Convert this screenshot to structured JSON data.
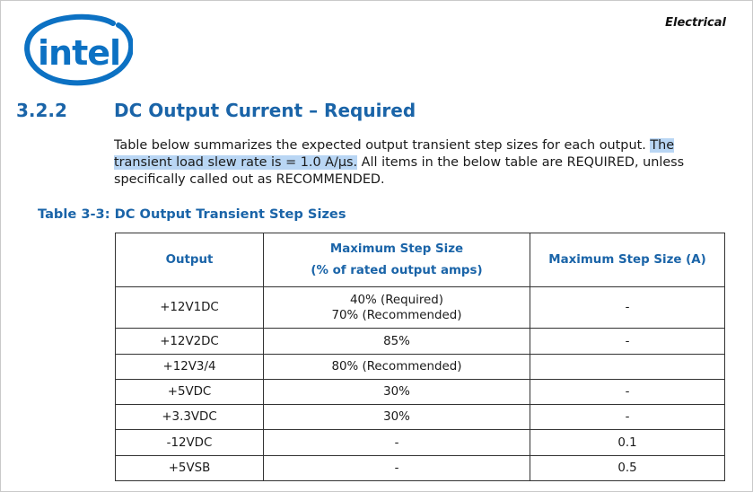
{
  "header": {
    "label": "Electrical"
  },
  "logo": {
    "text": "intel",
    "color": "#0c71c3"
  },
  "section": {
    "number": "3.2.2",
    "title": "DC Output Current – Required"
  },
  "paragraph": {
    "part1": "Table below summarizes the expected output transient step sizes for each output. ",
    "highlight": "The transient load slew rate is = 1.0 A/μs.",
    "part2": " All items in the below table are REQUIRED, unless specifically called out as RECOMMENDED."
  },
  "table": {
    "caption": "Table 3-3: DC Output Transient Step Sizes",
    "headers": {
      "output": "Output",
      "max_step_line1": "Maximum Step Size",
      "max_step_line2": "(% of rated output amps)",
      "max_step_a": "Maximum Step Size (A)"
    },
    "rows": [
      {
        "output": "+12V1DC",
        "pct": [
          "40% (Required)",
          "70% (Recommended)"
        ],
        "amps": "-"
      },
      {
        "output": "+12V2DC",
        "pct": [
          "85%"
        ],
        "amps": "-"
      },
      {
        "output": "+12V3/4",
        "pct": [
          "80% (Recommended)"
        ],
        "amps": ""
      },
      {
        "output": "+5VDC",
        "pct": [
          "30%"
        ],
        "amps": "-"
      },
      {
        "output": "+3.3VDC",
        "pct": [
          "30%"
        ],
        "amps": "-"
      },
      {
        "output": "-12VDC",
        "pct": [
          "-"
        ],
        "amps": "0.1"
      },
      {
        "output": "+5VSB",
        "pct": [
          "-"
        ],
        "amps": "0.5"
      }
    ]
  },
  "colors": {
    "heading_blue": "#1a64a8",
    "highlight": "#b9d6f4"
  }
}
